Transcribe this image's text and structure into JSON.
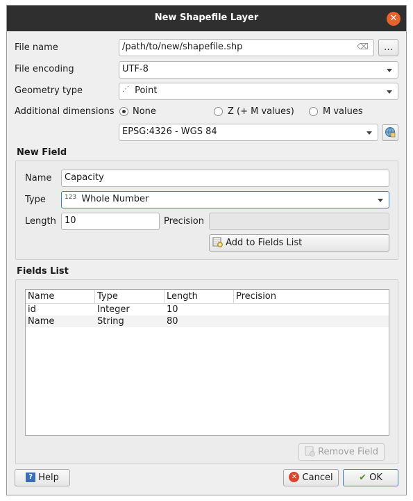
{
  "window": {
    "title": "New Shapefile Layer"
  },
  "form": {
    "file_name_label": "File name",
    "file_name_value": "/path/to/new/shapefile.shp",
    "browse_label": "…",
    "file_encoding_label": "File encoding",
    "file_encoding_value": "UTF-8",
    "geometry_type_label": "Geometry type",
    "geometry_type_value": "Point",
    "additional_dimensions_label": "Additional dimensions",
    "dimensions": {
      "none": "None",
      "zm": "Z (+ M values)",
      "m": "M values",
      "selected": "None"
    },
    "crs_value": "EPSG:4326 - WGS 84"
  },
  "new_field": {
    "title": "New Field",
    "name_label": "Name",
    "name_value": "Capacity",
    "type_label": "Type",
    "type_icon_text": "123",
    "type_value": "Whole Number",
    "length_label": "Length",
    "length_value": "10",
    "precision_label": "Precision",
    "precision_value": "",
    "add_button": "Add to Fields List"
  },
  "fields_list": {
    "title": "Fields List",
    "columns": [
      "Name",
      "Type",
      "Length",
      "Precision"
    ],
    "rows": [
      [
        "id",
        "Integer",
        "10",
        ""
      ],
      [
        "Name",
        "String",
        "80",
        ""
      ]
    ],
    "remove_button": "Remove Field"
  },
  "buttons": {
    "help": "Help",
    "cancel": "Cancel",
    "ok": "OK"
  },
  "colors": {
    "titlebar": "#2f2f2f",
    "close": "#e8622b",
    "focus": "#3b7dc4"
  }
}
